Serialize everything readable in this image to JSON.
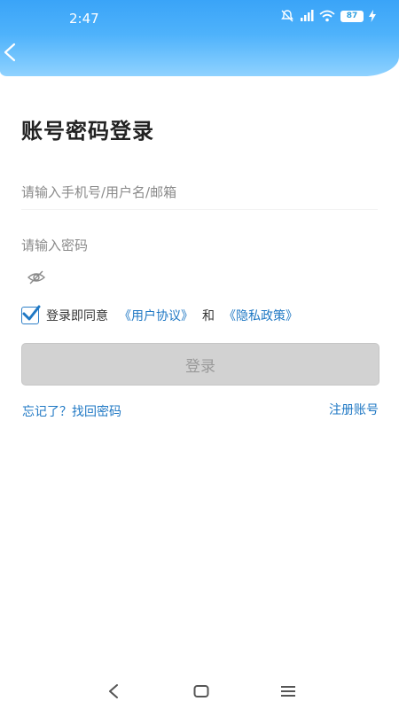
{
  "status_bar": {
    "time": "2:47",
    "battery": "87",
    "icons": [
      "mute-icon",
      "signal-icon",
      "wifi-icon",
      "battery-icon",
      "charging-icon"
    ]
  },
  "header": {
    "back_icon": "back-chevron-icon",
    "colors": {
      "gradient_top": "#3aa4f8",
      "gradient_bottom": "#8fd2ff"
    }
  },
  "page": {
    "title": "账号密码登录"
  },
  "form": {
    "account_placeholder": "请输入手机号/用户名/邮箱",
    "account_value": "",
    "password_placeholder": "请输入密码",
    "password_value": "",
    "password_toggle_icon": "eye-off-icon"
  },
  "agreement": {
    "checked": true,
    "prefix": "登录即同意",
    "user_agreement": "《用户协议》",
    "and": "和",
    "privacy_policy": "《隐私政策》"
  },
  "actions": {
    "login_label": "登录",
    "forgot_label": "忘记了？找回密码",
    "register_label": "注册账号"
  },
  "nav_bar": {
    "icons": [
      "back-icon",
      "home-icon",
      "menu-icon"
    ]
  },
  "colors": {
    "link": "#1f78c4",
    "button_disabled": "#d2d2d2",
    "title": "#222222"
  }
}
